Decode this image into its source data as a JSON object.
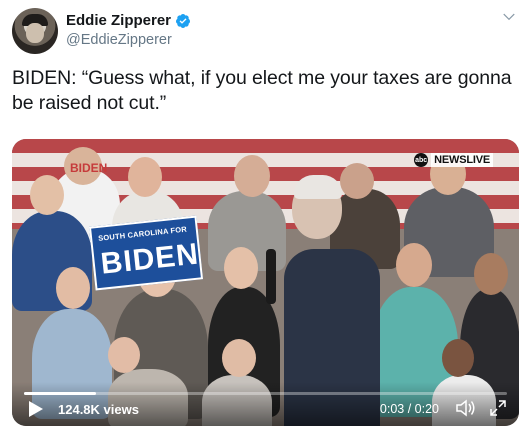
{
  "tweet": {
    "display_name": "Eddie Zipperer",
    "handle": "@EddieZipperer",
    "verified": true,
    "text_line1": "BIDEN: “Guess what, if you elect me your taxes are gonna",
    "text_line2": "be raised not cut.”"
  },
  "media": {
    "news_brand": "NEWSLIVE",
    "abc_mark": "abc",
    "sign_top": "SOUTH CAROLINA FOR",
    "sign_main": "BIDEN",
    "shirt_text": "BIDEN",
    "views": "124.8K views",
    "time": "0:03 / 0:20",
    "progress_fraction": 0.15
  },
  "colors": {
    "verified_blue": "#1da1f2",
    "handle_gray": "#657786",
    "text_dark": "#14171a"
  },
  "icons": [
    "avatar",
    "verified-badge-icon",
    "chevron-down-icon",
    "play-icon",
    "volume-icon",
    "expand-icon",
    "abc-logo-icon"
  ]
}
